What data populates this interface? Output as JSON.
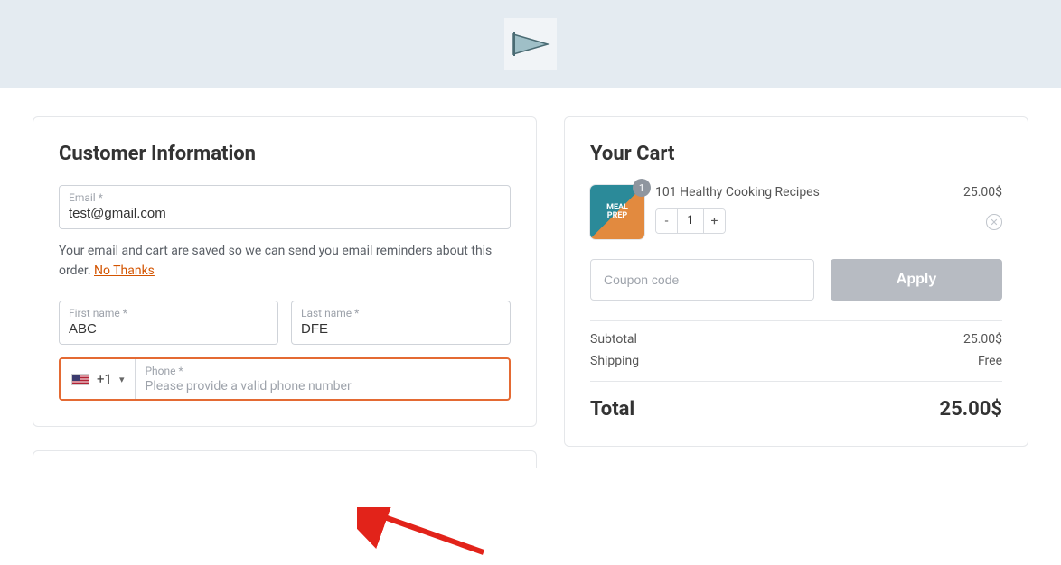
{
  "customer": {
    "title": "Customer Information",
    "email_label": "Email *",
    "email_value": "test@gmail.com",
    "reminder_text": "Your email and cart are saved so we can send you email reminders about this order. ",
    "no_thanks": "No Thanks",
    "first_name_label": "First name *",
    "first_name_value": "ABC",
    "last_name_label": "Last name *",
    "last_name_value": "DFE",
    "phone_label": "Phone *",
    "phone_prefix": "+1",
    "phone_error": "Please provide a valid phone number"
  },
  "cart": {
    "title": "Your Cart",
    "item": {
      "name": "101 Healthy Cooking Recipes",
      "price": "25.00$",
      "qty_badge": "1",
      "qty": "1",
      "thumb_line1": "MEAL",
      "thumb_line2": "PREP"
    },
    "coupon_placeholder": "Coupon code",
    "apply_label": "Apply",
    "subtotal_label": "Subtotal",
    "subtotal_value": "25.00$",
    "shipping_label": "Shipping",
    "shipping_value": "Free",
    "total_label": "Total",
    "total_value": "25.00$"
  }
}
